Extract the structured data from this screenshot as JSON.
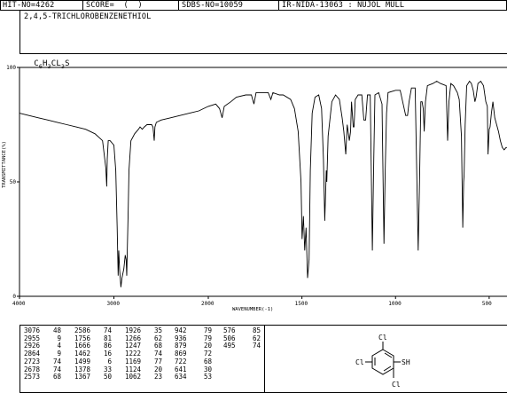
{
  "header": {
    "hit_no": "HIT-NO=4262",
    "score": "SCORE=  (  )",
    "sdbs_no": "SDBS-NO=10059",
    "ir_info": "IR-NIDA-13063 : NUJOL MULL",
    "compound_name": "2,4,5-TRICHLOROBENZENETHIOL",
    "formula_parts": [
      "C",
      "6",
      "H",
      "3",
      "CL",
      "3",
      "S"
    ]
  },
  "chart_data": {
    "type": "line",
    "title": "",
    "xlabel": "WAVENUMBER(-1)",
    "ylabel": "TRANSMITTANCE(%)",
    "xlim": [
      4000,
      400
    ],
    "ylim": [
      0,
      100
    ],
    "x_ticks": [
      {
        "value": 4000,
        "label": "4000"
      },
      {
        "value": 3000,
        "label": "3000"
      },
      {
        "value": 2000,
        "label": "2000"
      },
      {
        "value": 1500,
        "label": "1500"
      },
      {
        "value": 1000,
        "label": "1000"
      },
      {
        "value": 500,
        "label": "500"
      }
    ],
    "y_ticks": [
      {
        "value": 100,
        "label": "100"
      },
      {
        "value": 50,
        "label": "50"
      },
      {
        "value": 0,
        "label": "0"
      }
    ],
    "series": [
      {
        "points": [
          [
            4000,
            80
          ],
          [
            3900,
            79
          ],
          [
            3800,
            78
          ],
          [
            3700,
            77
          ],
          [
            3600,
            76
          ],
          [
            3500,
            75
          ],
          [
            3400,
            74
          ],
          [
            3300,
            73
          ],
          [
            3200,
            71
          ],
          [
            3120,
            68
          ],
          [
            3085,
            56
          ],
          [
            3076,
            48
          ],
          [
            3070,
            60
          ],
          [
            3060,
            68
          ],
          [
            3040,
            68
          ],
          [
            3000,
            66
          ],
          [
            2980,
            55
          ],
          [
            2965,
            30
          ],
          [
            2955,
            9
          ],
          [
            2948,
            20
          ],
          [
            2940,
            12
          ],
          [
            2926,
            4
          ],
          [
            2915,
            8
          ],
          [
            2895,
            12
          ],
          [
            2880,
            18
          ],
          [
            2870,
            16
          ],
          [
            2864,
            9
          ],
          [
            2858,
            20
          ],
          [
            2850,
            35
          ],
          [
            2840,
            55
          ],
          [
            2820,
            68
          ],
          [
            2780,
            71
          ],
          [
            2740,
            73
          ],
          [
            2723,
            74
          ],
          [
            2700,
            73
          ],
          [
            2678,
            74
          ],
          [
            2650,
            75
          ],
          [
            2620,
            75
          ],
          [
            2600,
            75
          ],
          [
            2586,
            74
          ],
          [
            2573,
            68
          ],
          [
            2565,
            74
          ],
          [
            2550,
            76
          ],
          [
            2500,
            77
          ],
          [
            2400,
            78
          ],
          [
            2300,
            79
          ],
          [
            2200,
            80
          ],
          [
            2100,
            81
          ],
          [
            2050,
            82
          ],
          [
            2000,
            83
          ],
          [
            1960,
            84
          ],
          [
            1940,
            82
          ],
          [
            1926,
            78
          ],
          [
            1915,
            83
          ],
          [
            1880,
            85
          ],
          [
            1850,
            87
          ],
          [
            1800,
            88
          ],
          [
            1770,
            88
          ],
          [
            1756,
            84
          ],
          [
            1745,
            89
          ],
          [
            1700,
            89
          ],
          [
            1680,
            89
          ],
          [
            1666,
            86
          ],
          [
            1655,
            89
          ],
          [
            1620,
            88
          ],
          [
            1600,
            88
          ],
          [
            1560,
            86
          ],
          [
            1540,
            82
          ],
          [
            1520,
            72
          ],
          [
            1505,
            50
          ],
          [
            1499,
            25
          ],
          [
            1492,
            35
          ],
          [
            1485,
            20
          ],
          [
            1478,
            30
          ],
          [
            1470,
            8
          ],
          [
            1462,
            16
          ],
          [
            1455,
            55
          ],
          [
            1445,
            80
          ],
          [
            1430,
            87
          ],
          [
            1410,
            88
          ],
          [
            1395,
            82
          ],
          [
            1385,
            60
          ],
          [
            1378,
            33
          ],
          [
            1370,
            55
          ],
          [
            1367,
            50
          ],
          [
            1360,
            70
          ],
          [
            1340,
            85
          ],
          [
            1320,
            88
          ],
          [
            1300,
            86
          ],
          [
            1285,
            78
          ],
          [
            1276,
            72
          ],
          [
            1266,
            62
          ],
          [
            1258,
            75
          ],
          [
            1247,
            68
          ],
          [
            1240,
            72
          ],
          [
            1235,
            85
          ],
          [
            1226,
            74
          ],
          [
            1222,
            74
          ],
          [
            1215,
            86
          ],
          [
            1200,
            88
          ],
          [
            1180,
            88
          ],
          [
            1169,
            77
          ],
          [
            1160,
            77
          ],
          [
            1150,
            88
          ],
          [
            1135,
            88
          ],
          [
            1124,
            20
          ],
          [
            1116,
            60
          ],
          [
            1110,
            88
          ],
          [
            1090,
            89
          ],
          [
            1072,
            84
          ],
          [
            1062,
            23
          ],
          [
            1055,
            55
          ],
          [
            1048,
            80
          ],
          [
            1040,
            89
          ],
          [
            1000,
            90
          ],
          [
            975,
            90
          ],
          [
            962,
            85
          ],
          [
            946,
            79
          ],
          [
            942,
            79
          ],
          [
            936,
            79
          ],
          [
            928,
            85
          ],
          [
            915,
            91
          ],
          [
            895,
            91
          ],
          [
            879,
            20
          ],
          [
            872,
            50
          ],
          [
            865,
            85
          ],
          [
            858,
            85
          ],
          [
            852,
            82
          ],
          [
            847,
            72
          ],
          [
            840,
            85
          ],
          [
            830,
            92
          ],
          [
            800,
            93
          ],
          [
            780,
            94
          ],
          [
            760,
            93
          ],
          [
            730,
            92
          ],
          [
            722,
            68
          ],
          [
            715,
            85
          ],
          [
            705,
            93
          ],
          [
            690,
            92
          ],
          [
            670,
            89
          ],
          [
            660,
            86
          ],
          [
            648,
            70
          ],
          [
            641,
            30
          ],
          [
            636,
            50
          ],
          [
            634,
            53
          ],
          [
            628,
            75
          ],
          [
            620,
            92
          ],
          [
            605,
            94
          ],
          [
            595,
            93
          ],
          [
            585,
            90
          ],
          [
            576,
            85
          ],
          [
            570,
            87
          ],
          [
            560,
            93
          ],
          [
            545,
            94
          ],
          [
            530,
            92
          ],
          [
            518,
            85
          ],
          [
            510,
            83
          ],
          [
            506,
            62
          ],
          [
            500,
            73
          ],
          [
            495,
            74
          ],
          [
            488,
            80
          ],
          [
            480,
            85
          ],
          [
            470,
            78
          ],
          [
            460,
            75
          ],
          [
            450,
            72
          ],
          [
            440,
            68
          ],
          [
            430,
            65
          ],
          [
            420,
            64
          ],
          [
            410,
            65
          ],
          [
            400,
            65
          ]
        ]
      }
    ]
  },
  "peak_table": {
    "columns": [
      [
        [
          "3076",
          "48"
        ],
        [
          "2955",
          "9"
        ],
        [
          "2926",
          "4"
        ],
        [
          "2864",
          "9"
        ],
        [
          "2723",
          "74"
        ],
        [
          "2678",
          "74"
        ],
        [
          "2573",
          "68"
        ]
      ],
      [
        [
          "2586",
          "74"
        ],
        [
          "1756",
          "81"
        ],
        [
          "1666",
          "86"
        ],
        [
          "1462",
          "16"
        ],
        [
          "1499",
          "6"
        ],
        [
          "1378",
          "33"
        ],
        [
          "1367",
          "50"
        ]
      ],
      [
        [
          "1926",
          "35"
        ],
        [
          "1266",
          "62"
        ],
        [
          "1247",
          "68"
        ],
        [
          "1222",
          "74"
        ],
        [
          "1169",
          "77"
        ],
        [
          "1124",
          "20"
        ],
        [
          "1062",
          "23"
        ]
      ],
      [
        [
          "942",
          "79"
        ],
        [
          "936",
          "79"
        ],
        [
          "879",
          "20"
        ],
        [
          "869",
          "72"
        ],
        [
          "722",
          "68"
        ],
        [
          "641",
          "30"
        ],
        [
          "634",
          "53"
        ]
      ],
      [
        [
          "576",
          "85"
        ],
        [
          "506",
          "62"
        ],
        [
          "495",
          "74"
        ]
      ]
    ]
  },
  "structure": {
    "atom_labels": [
      "Cl",
      "Cl",
      "SH",
      "Cl"
    ]
  },
  "colors": {
    "ink": "#000000",
    "background": "#ffffff"
  }
}
